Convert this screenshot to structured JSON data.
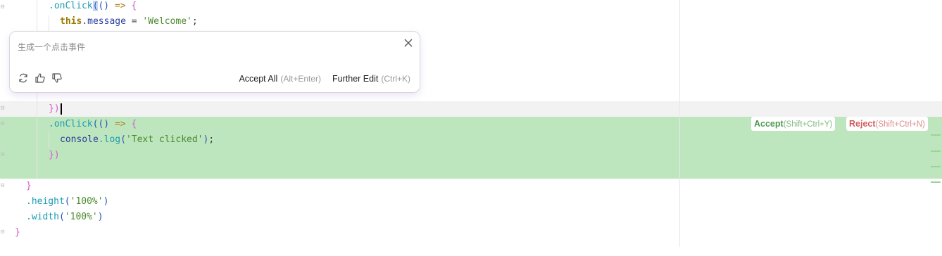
{
  "editor": {
    "lines": [
      {
        "id": "l1"
      },
      {
        "id": "l2"
      }
    ],
    "tokens": {
      "onclick1_dot": ".",
      "onclick1_fn": "onClick",
      "onclick1_paren_open": "(",
      "onclick1_rest": "() ",
      "onclick1_arrow": "=>",
      "onclick1_brace": "{",
      "this_kw": "this",
      "this_prop": ".message",
      "this_op": " = ",
      "this_str": "'Welcome'",
      "this_semi": ";",
      "close1": "})",
      "onclick2_dot": ".",
      "onclick2_fn": "onClick",
      "onclick2_paren": "(() ",
      "onclick2_arrow": "=>",
      "onclick2_brace": "{",
      "console_id": "console",
      "console_dot": ".",
      "console_fn": "log",
      "console_paren_open": "(",
      "console_str": "'Text clicked'",
      "console_paren_close": ")",
      "console_semi": ";",
      "close2": "})",
      "close3": "}",
      "height_dot": ".",
      "height_fn": "height",
      "height_arg_open": "(",
      "height_str": "'100%'",
      "height_arg_close": ")",
      "width_dot": ".",
      "width_fn": "width",
      "width_arg_open": "(",
      "width_str": "'100%'",
      "width_arg_close": ")",
      "close4": "}"
    }
  },
  "ai_popup": {
    "prompt_text": "生成一个点击事件",
    "accept_all_label": "Accept All",
    "accept_all_shortcut": "(Alt+Enter)",
    "further_edit_label": "Further Edit",
    "further_edit_shortcut": "(Ctrl+K)",
    "icons": [
      "refresh-icon",
      "thumbs-up-icon",
      "thumbs-down-icon",
      "close-icon"
    ]
  },
  "diff_actions": {
    "accept_label": "Accept",
    "accept_shortcut": "(Shift+Ctrl+Y)",
    "reject_label": "Reject",
    "reject_shortcut": "(Shift+Ctrl+N)"
  },
  "colors": {
    "inserted_block": "#bde6be",
    "accept": "#4d9a4e",
    "reject": "#d05a5a"
  }
}
